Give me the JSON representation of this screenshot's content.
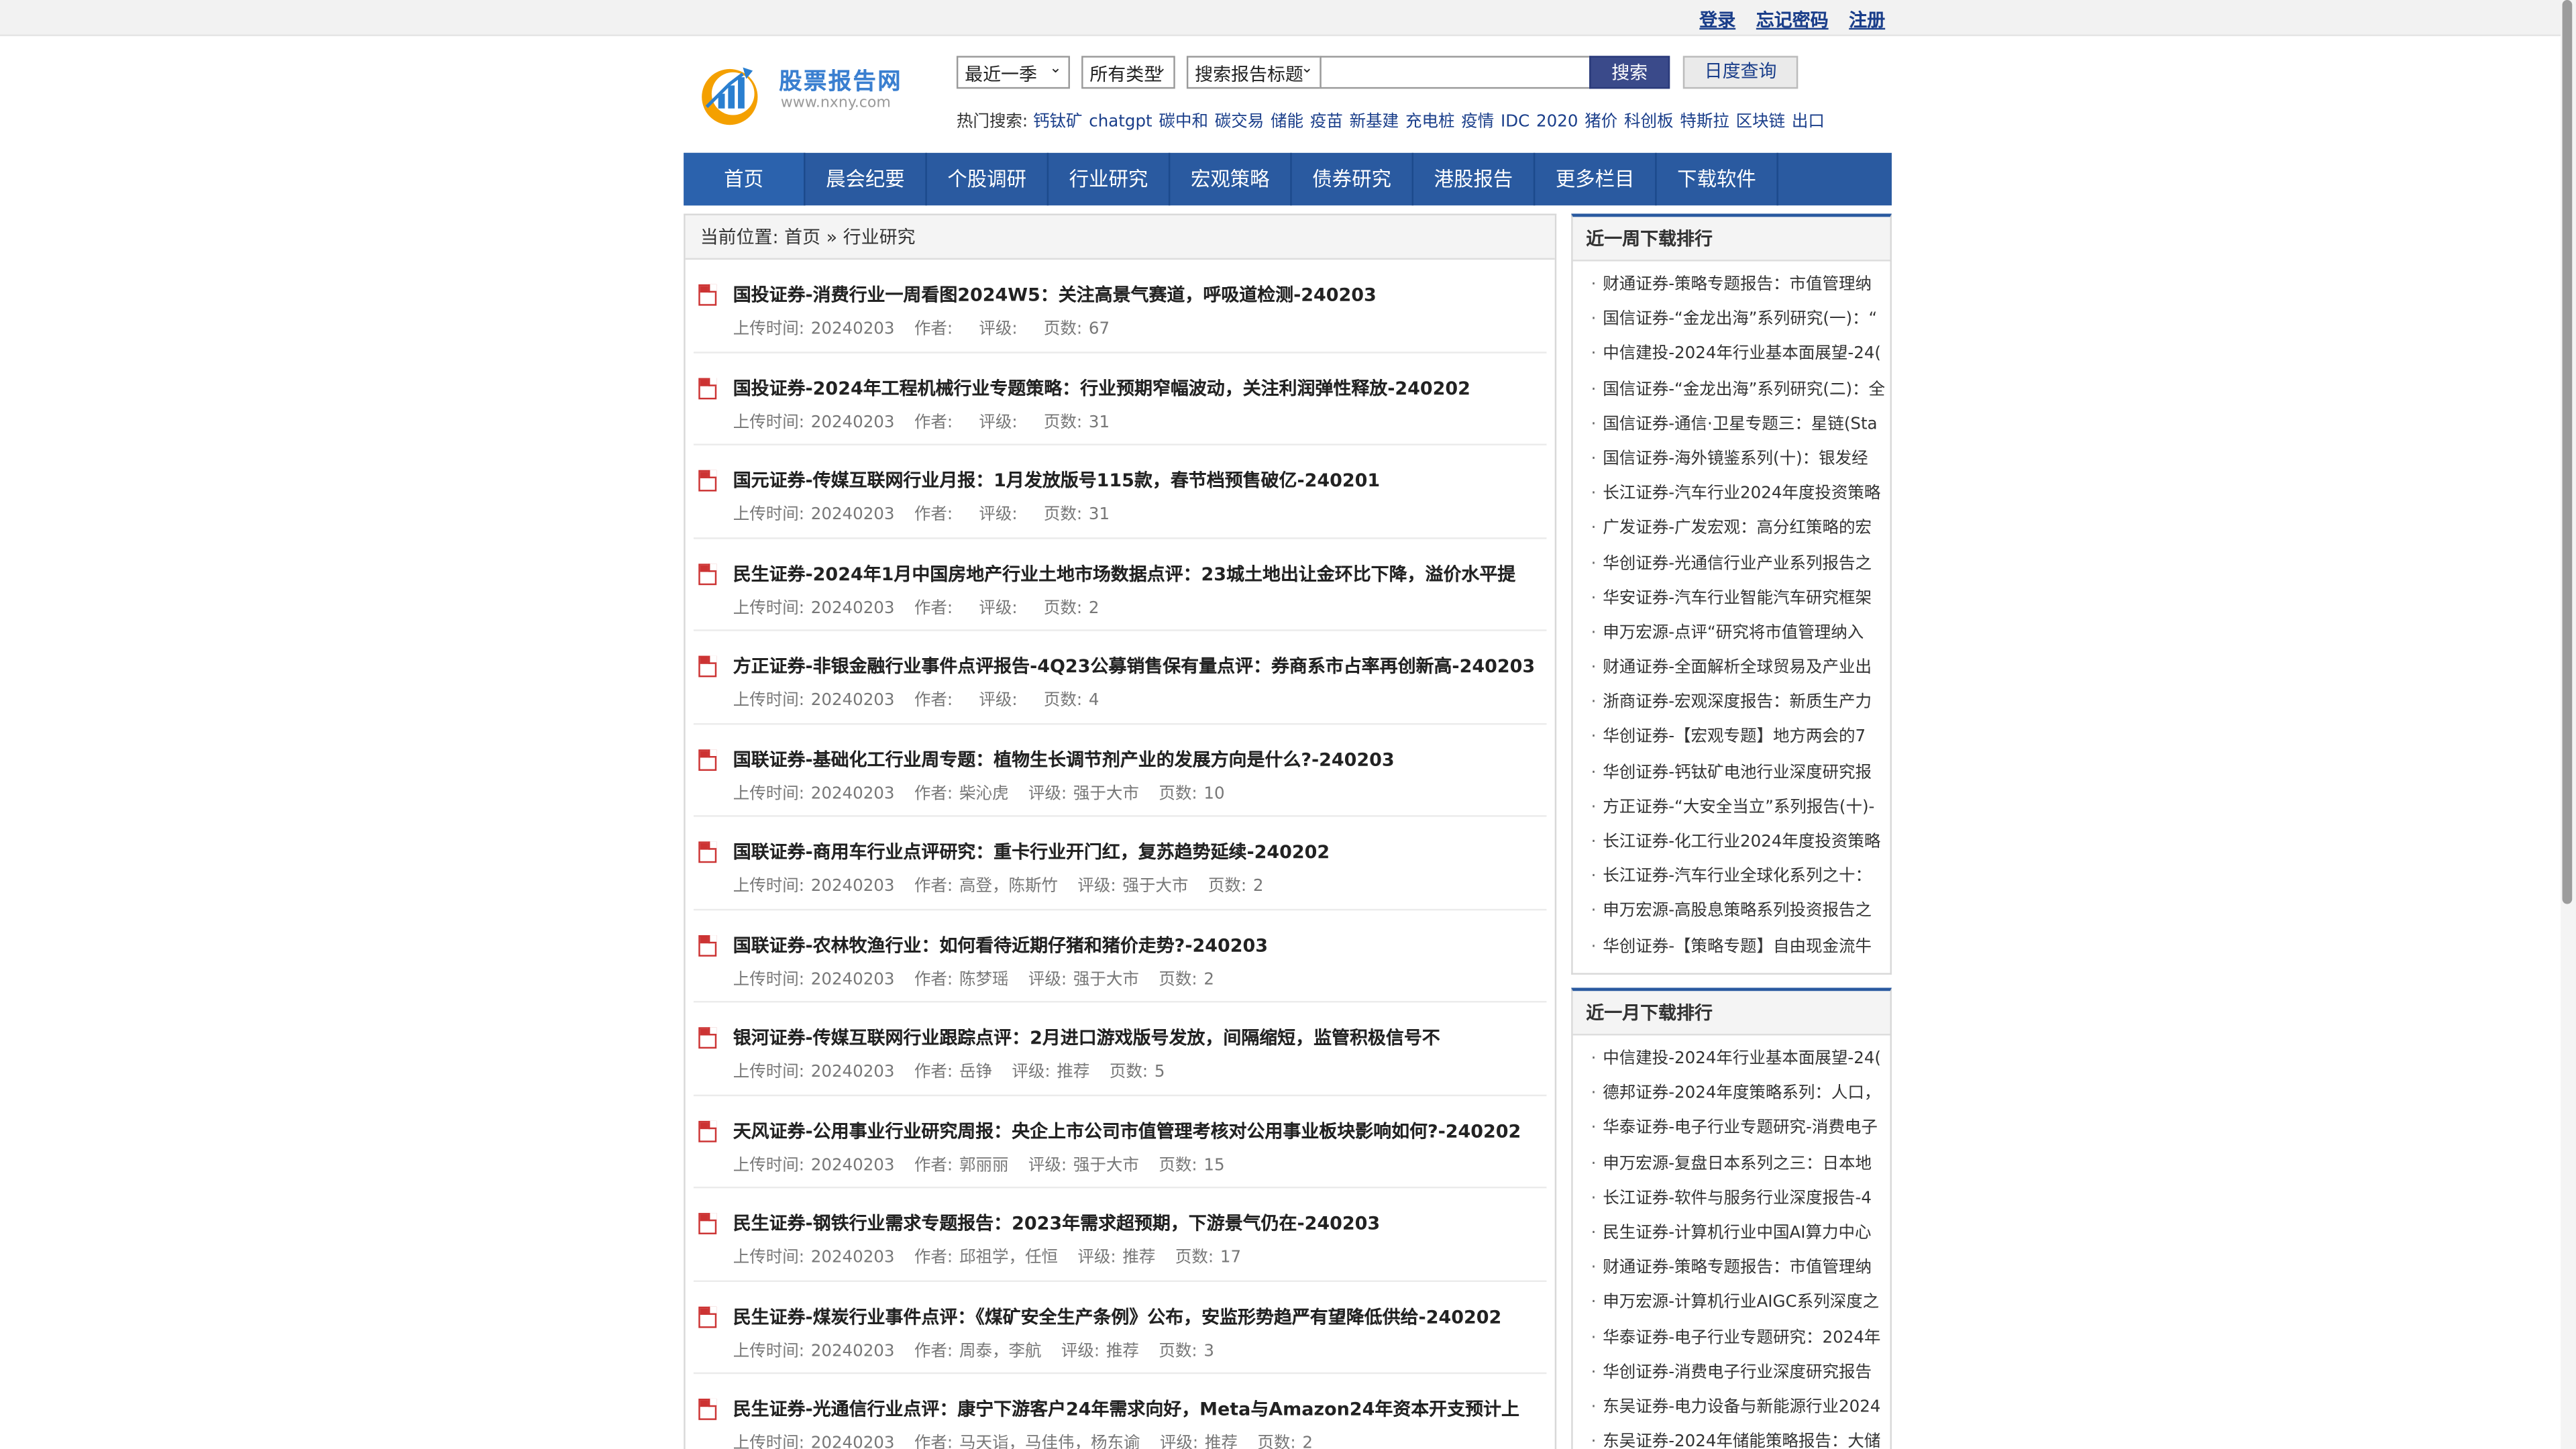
{
  "toplinks": {
    "login": "登录",
    "forgot": "忘记密码",
    "register": "注册"
  },
  "logo": {
    "name": "股票报告网",
    "url": "www.nxny.com"
  },
  "search": {
    "period": "最近一季",
    "type": "所有类型",
    "field": "搜索报告标题",
    "input_value": "",
    "search_button": "搜索",
    "date_button": "日度查询"
  },
  "hot": {
    "label": "热门搜索:",
    "keywords": [
      "钙钛矿",
      "chatgpt",
      "碳中和",
      "碳交易",
      "储能",
      "疫苗",
      "新基建",
      "充电桩",
      "疫情",
      "IDC",
      "2020",
      "猪价",
      "科创板",
      "特斯拉",
      "区块链",
      "出口"
    ]
  },
  "nav": [
    "首页",
    "晨会纪要",
    "个股调研",
    "行业研究",
    "宏观策略",
    "债券研究",
    "港股报告",
    "更多栏目",
    "下载软件"
  ],
  "breadcrumb": "当前位置: 首页 » 行业研究",
  "meta_labels": {
    "upload": "上传时间:",
    "author": "作者:",
    "rating": "评级:",
    "pages": "页数:"
  },
  "reports": [
    {
      "title": "国投证券-消费行业一周看图2024W5：关注高景气赛道，呼吸道检测-240203",
      "date": "20240203",
      "author": "",
      "rating": "",
      "pages": "67"
    },
    {
      "title": "国投证券-2024年工程机械行业专题策略：行业预期窄幅波动，关注利润弹性释放-240202",
      "date": "20240203",
      "author": "",
      "rating": "",
      "pages": "31"
    },
    {
      "title": "国元证券-传媒互联网行业月报：1月发放版号115款，春节档预售破亿-240201",
      "date": "20240203",
      "author": "",
      "rating": "",
      "pages": "31"
    },
    {
      "title": "民生证券-2024年1月中国房地产行业土地市场数据点评：23城土地出让金环比下降，溢价水平提",
      "date": "20240203",
      "author": "",
      "rating": "",
      "pages": "2"
    },
    {
      "title": "方正证券-非银金融行业事件点评报告-4Q23公募销售保有量点评：券商系市占率再创新高-240203",
      "date": "20240203",
      "author": "",
      "rating": "",
      "pages": "4"
    },
    {
      "title": "国联证券-基础化工行业周专题：植物生长调节剂产业的发展方向是什么?-240203",
      "date": "20240203",
      "author": "柴沁虎",
      "rating": "强于大市",
      "pages": "10"
    },
    {
      "title": "国联证券-商用车行业点评研究：重卡行业开门红，复苏趋势延续-240202",
      "date": "20240203",
      "author": "高登，陈斯竹",
      "rating": "强于大市",
      "pages": "2"
    },
    {
      "title": "国联证券-农林牧渔行业：如何看待近期仔猪和猪价走势?-240203",
      "date": "20240203",
      "author": "陈梦瑶",
      "rating": "强于大市",
      "pages": "2"
    },
    {
      "title": "银河证券-传媒互联网行业跟踪点评：2月进口游戏版号发放，间隔缩短，监管积极信号不",
      "date": "20240203",
      "author": "岳铮",
      "rating": "推荐",
      "pages": "5"
    },
    {
      "title": "天风证券-公用事业行业研究周报：央企上市公司市值管理考核对公用事业板块影响如何?-240202",
      "date": "20240203",
      "author": "郭丽丽",
      "rating": "强于大市",
      "pages": "15"
    },
    {
      "title": "民生证券-钢铁行业需求专题报告：2023年需求超预期，下游景气仍在-240203",
      "date": "20240203",
      "author": "邱祖学，任恒",
      "rating": "推荐",
      "pages": "17"
    },
    {
      "title": "民生证券-煤炭行业事件点评：《煤矿安全生产条例》公布，安监形势趋严有望降低供给-240202",
      "date": "20240203",
      "author": "周泰，李航",
      "rating": "推荐",
      "pages": "3"
    },
    {
      "title": "民生证券-光通信行业点评：康宁下游客户24年需求向好，Meta与Amazon24年资本开支预计上",
      "date": "20240203",
      "author": "马天诣，马佳伟，杨东谕",
      "rating": "推荐",
      "pages": "2"
    }
  ],
  "weekly": {
    "title": "近一周下载排行",
    "items": [
      "财通证券-策略专题报告：市值管理纳",
      "国信证券-“金龙出海”系列研究(一)：“",
      "中信建投-2024年行业基本面展望-24(",
      "国信证券-“金龙出海”系列研究(二)：全",
      "国信证券-通信·卫星专题三：星链(Sta",
      "国信证券-海外镜鉴系列(十)：银发经",
      "长江证券-汽车行业2024年度投资策略",
      "广发证券-广发宏观：高分红策略的宏",
      "华创证券-光通信行业产业系列报告之",
      "华安证券-汽车行业智能汽车研究框架",
      "申万宏源-点评“研究将市值管理纳入",
      "财通证券-全面解析全球贸易及产业出",
      "浙商证券-宏观深度报告：新质生产力",
      "华创证券-【宏观专题】地方两会的7",
      "华创证券-钙钛矿电池行业深度研究报",
      "方正证券-“大安全当立”系列报告(十)-",
      "长江证券-化工行业2024年度投资策略",
      "长江证券-汽车行业全球化系列之十：",
      "申万宏源-高股息策略系列投资报告之",
      "华创证券-【策略专题】自由现金流牛"
    ]
  },
  "monthly": {
    "title": "近一月下载排行",
    "items": [
      "中信建投-2024年行业基本面展望-24(",
      "德邦证券-2024年度策略系列：人口，",
      "华泰证券-电子行业专题研究-消费电子",
      "申万宏源-复盘日本系列之三：日本地",
      "长江证券-软件与服务行业深度报告-4",
      "民生证券-计算机行业中国AI算力中心",
      "财通证券-策略专题报告：市值管理纳",
      "申万宏源-计算机行业AIGC系列深度之",
      "华泰证券-电子行业专题研究：2024年",
      "华创证券-消费电子行业深度研究报告",
      "东吴证券-电力设备与新能源行业2024",
      "东吴证券-2024年储能策略报告：大储"
    ]
  }
}
